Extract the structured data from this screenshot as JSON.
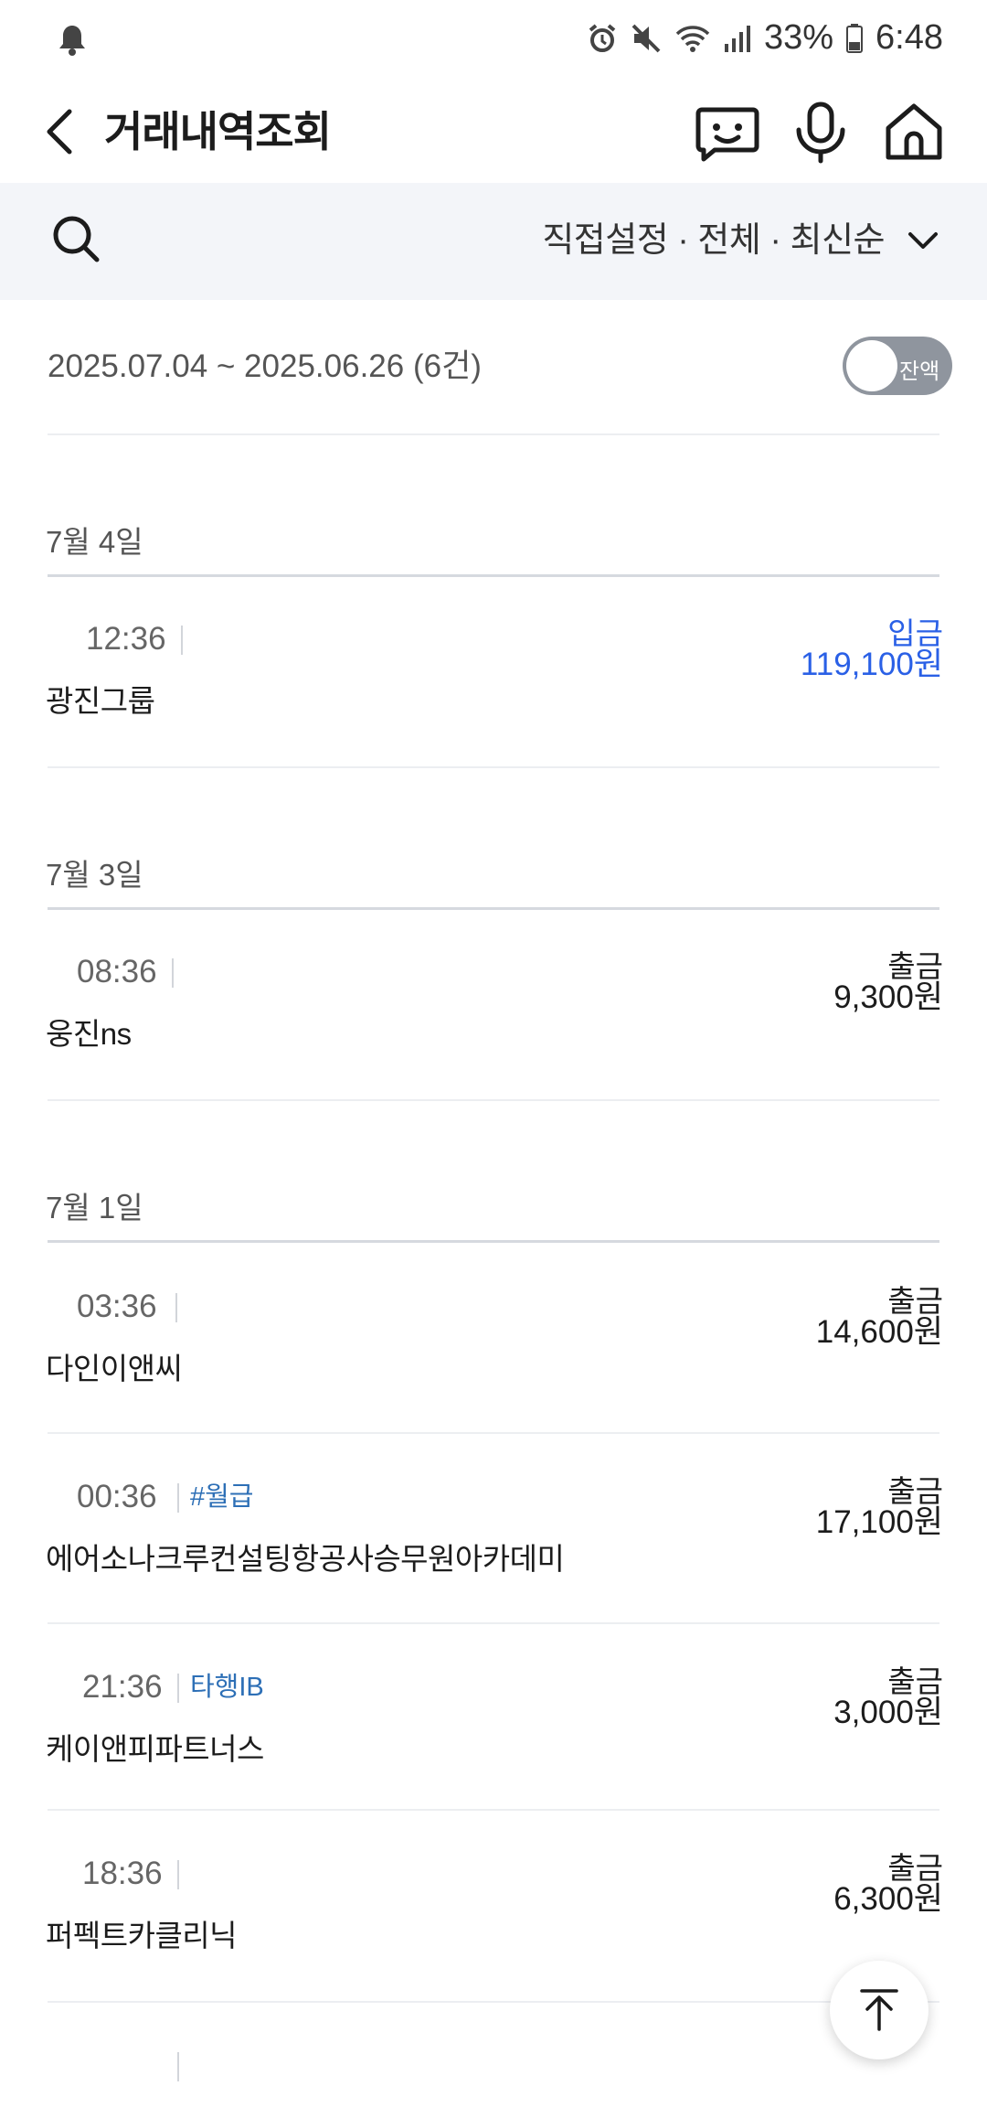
{
  "status_bar": {
    "battery": "33%",
    "time": "6:48",
    "icons": [
      "notification-bell-icon",
      "alarm-icon",
      "mute-icon",
      "wifi-icon",
      "signal-icon",
      "battery-icon"
    ]
  },
  "header": {
    "title": "거래내역조회",
    "icons": [
      "back-icon",
      "chatbot-icon",
      "microphone-icon",
      "home-icon"
    ]
  },
  "filter": {
    "text": "직접설정 · 전체 · 최신순",
    "icons": [
      "search-icon",
      "chevron-down-icon"
    ]
  },
  "range": {
    "text": "2025.07.04 ~ 2025.06.26 (6건)",
    "balance_toggle_label": "잔액"
  },
  "colors": {
    "deposit": "#2a60e6",
    "withdrawal": "#1c1c1c",
    "tag": "#2d6fb6"
  },
  "groups": [
    {
      "date": "7월 4일",
      "transactions": [
        {
          "time": "12:36",
          "tag": "",
          "name": "광진그룹",
          "type": "입금",
          "amount": "119,100원"
        }
      ]
    },
    {
      "date": "7월 3일",
      "transactions": [
        {
          "time": "08:36",
          "tag": "",
          "name": "웅진ns",
          "type": "출금",
          "amount": "9,300원"
        }
      ]
    },
    {
      "date": "7월 1일",
      "transactions": [
        {
          "time": "03:36",
          "tag": "",
          "name": "다인이앤씨",
          "type": "출금",
          "amount": "14,600원"
        },
        {
          "time": "00:36",
          "tag": "#월급",
          "name": "에어소나크루컨설팅항공사승무원아카데미",
          "type": "출금",
          "amount": "17,100원"
        },
        {
          "time": "21:36",
          "tag": "타행IB",
          "name": "케이앤피파트너스",
          "type": "출금",
          "amount": "3,000원"
        },
        {
          "time": "18:36",
          "tag": "",
          "name": "퍼펙트카클리닉",
          "type": "출금",
          "amount": "6,300원"
        }
      ]
    }
  ]
}
